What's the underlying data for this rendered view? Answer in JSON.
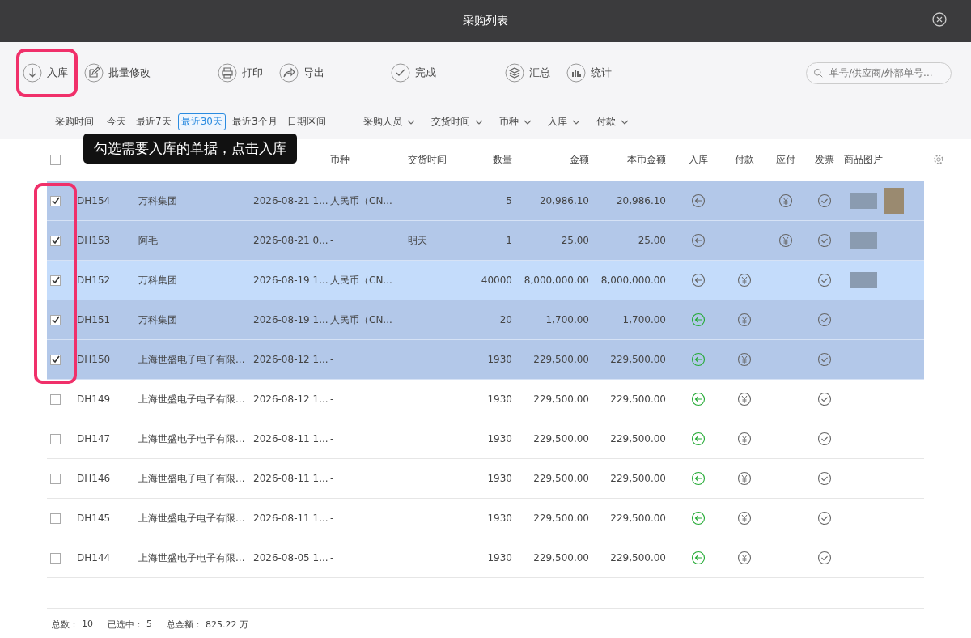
{
  "window": {
    "title": "采购列表"
  },
  "toolbar": [
    [
      {
        "label": "入库",
        "highlighted": true
      },
      {
        "label": "批量修改",
        "highlighted": false
      }
    ],
    [
      {
        "label": "打印",
        "highlighted": false
      },
      {
        "label": "导出",
        "highlighted": false
      }
    ],
    [
      {
        "label": "完成",
        "highlighted": false
      }
    ],
    [
      {
        "label": "汇总",
        "highlighted": false
      },
      {
        "label": "统计",
        "highlighted": false
      }
    ]
  ],
  "search": {
    "placeholder": "单号/供应商/外部单号..."
  },
  "date_filter": {
    "label": "采购时间",
    "options": [
      {
        "label": "今天",
        "selected": false
      },
      {
        "label": "最近7天",
        "selected": false
      },
      {
        "label": "最近30天",
        "selected": true
      },
      {
        "label": "最近3个月",
        "selected": false
      },
      {
        "label": "日期区间",
        "selected": false
      }
    ]
  },
  "dropdowns": [
    "采购人员",
    "交货时间",
    "币种",
    "入库",
    "付款"
  ],
  "tooltip": "勾选需要入库的单据，点击入库",
  "table": {
    "select_all_checked": false,
    "checkbox_column_highlighted": true,
    "columns": [
      "币种",
      "交货时间",
      "数量",
      "金额",
      "本币金额",
      "入库",
      "付款",
      "应付",
      "发票",
      "商品图片"
    ],
    "rows": [
      {
        "checked": true,
        "hovered": false,
        "no": "DH154",
        "supplier": "万科集团",
        "time": "2026-08-21 1...",
        "currency": "人民币（CN...",
        "delivery": "",
        "qty": "5",
        "amount": "20,986.10",
        "local_amount": "20,986.10",
        "stocked": false,
        "paid": false,
        "payable": true,
        "invoice": true,
        "images": [
          {
            "kind": "wide"
          },
          {
            "kind": "tall"
          }
        ]
      },
      {
        "checked": true,
        "hovered": false,
        "no": "DH153",
        "supplier": "阿毛",
        "time": "2026-08-21 0...",
        "currency": "-",
        "delivery": "明天",
        "qty": "1",
        "amount": "25.00",
        "local_amount": "25.00",
        "stocked": false,
        "paid": false,
        "payable": true,
        "invoice": true,
        "images": [
          {
            "kind": "wide"
          }
        ]
      },
      {
        "checked": true,
        "hovered": true,
        "no": "DH152",
        "supplier": "万科集团",
        "time": "2026-08-19 1...",
        "currency": "人民币（CN...",
        "delivery": "",
        "qty": "40000",
        "amount": "8,000,000.00",
        "local_amount": "8,000,000.00",
        "stocked": false,
        "paid": true,
        "payable": false,
        "invoice": true,
        "images": [
          {
            "kind": "wide"
          }
        ]
      },
      {
        "checked": true,
        "hovered": false,
        "no": "DH151",
        "supplier": "万科集团",
        "time": "2026-08-19 1...",
        "currency": "人民币（CN...",
        "delivery": "",
        "qty": "20",
        "amount": "1,700.00",
        "local_amount": "1,700.00",
        "stocked": true,
        "paid": true,
        "payable": false,
        "invoice": true,
        "images": []
      },
      {
        "checked": true,
        "hovered": false,
        "no": "DH150",
        "supplier": "上海世盛电子电子有限...",
        "time": "2026-08-12 1...",
        "currency": "-",
        "delivery": "",
        "qty": "1930",
        "amount": "229,500.00",
        "local_amount": "229,500.00",
        "stocked": true,
        "paid": true,
        "payable": false,
        "invoice": true,
        "images": []
      },
      {
        "checked": false,
        "hovered": false,
        "no": "DH149",
        "supplier": "上海世盛电子电子有限...",
        "time": "2026-08-12 1...",
        "currency": "-",
        "delivery": "",
        "qty": "1930",
        "amount": "229,500.00",
        "local_amount": "229,500.00",
        "stocked": true,
        "paid": true,
        "payable": false,
        "invoice": true,
        "images": []
      },
      {
        "checked": false,
        "hovered": false,
        "no": "DH147",
        "supplier": "上海世盛电子电子有限...",
        "time": "2026-08-11 1...",
        "currency": "-",
        "delivery": "",
        "qty": "1930",
        "amount": "229,500.00",
        "local_amount": "229,500.00",
        "stocked": true,
        "paid": true,
        "payable": false,
        "invoice": true,
        "images": []
      },
      {
        "checked": false,
        "hovered": false,
        "no": "DH146",
        "supplier": "上海世盛电子电子有限...",
        "time": "2026-08-11 1...",
        "currency": "-",
        "delivery": "",
        "qty": "1930",
        "amount": "229,500.00",
        "local_amount": "229,500.00",
        "stocked": true,
        "paid": true,
        "payable": false,
        "invoice": true,
        "images": []
      },
      {
        "checked": false,
        "hovered": false,
        "no": "DH145",
        "supplier": "上海世盛电子电子有限...",
        "time": "2026-08-11 1...",
        "currency": "-",
        "delivery": "",
        "qty": "1930",
        "amount": "229,500.00",
        "local_amount": "229,500.00",
        "stocked": true,
        "paid": true,
        "payable": false,
        "invoice": true,
        "images": []
      },
      {
        "checked": false,
        "hovered": false,
        "no": "DH144",
        "supplier": "上海世盛电子电子有限...",
        "time": "2026-08-05 1...",
        "currency": "-",
        "delivery": "",
        "qty": "1930",
        "amount": "229,500.00",
        "local_amount": "229,500.00",
        "stocked": true,
        "paid": true,
        "payable": false,
        "invoice": true,
        "images": []
      }
    ]
  },
  "footer": [
    {
      "label": "总数：",
      "value": "10"
    },
    {
      "label": "已选中：",
      "value": "5"
    },
    {
      "label": "总金额：",
      "value": "825.22 万"
    }
  ]
}
